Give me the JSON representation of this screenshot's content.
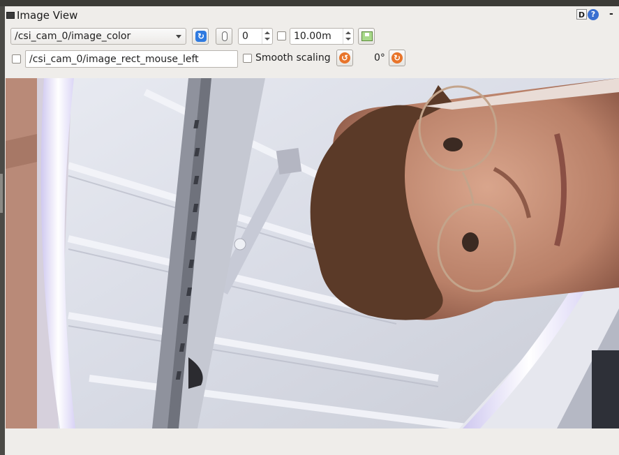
{
  "window": {
    "title": "Image View"
  },
  "title_bar": {
    "d_label": "D",
    "help_label": "?",
    "minimize_label": "-"
  },
  "toolbar": {
    "topic_combo": "/csi_cam_0/image_color",
    "value_spin": "0",
    "max_spin": "10.00m"
  },
  "row2": {
    "mouse_topic": "/csi_cam_0/image_rect_mouse_left",
    "smooth_scaling_label": "Smooth scaling",
    "rotation_label": "0°"
  },
  "icons": {
    "refresh": "refresh-icon",
    "mouse": "mouse-icon",
    "save": "save-icon",
    "rotate_left": "rotate-left-icon",
    "rotate_right": "rotate-right-icon"
  },
  "colors": {
    "accent_blue": "#2f7ae0",
    "accent_orange": "#e8742a"
  }
}
